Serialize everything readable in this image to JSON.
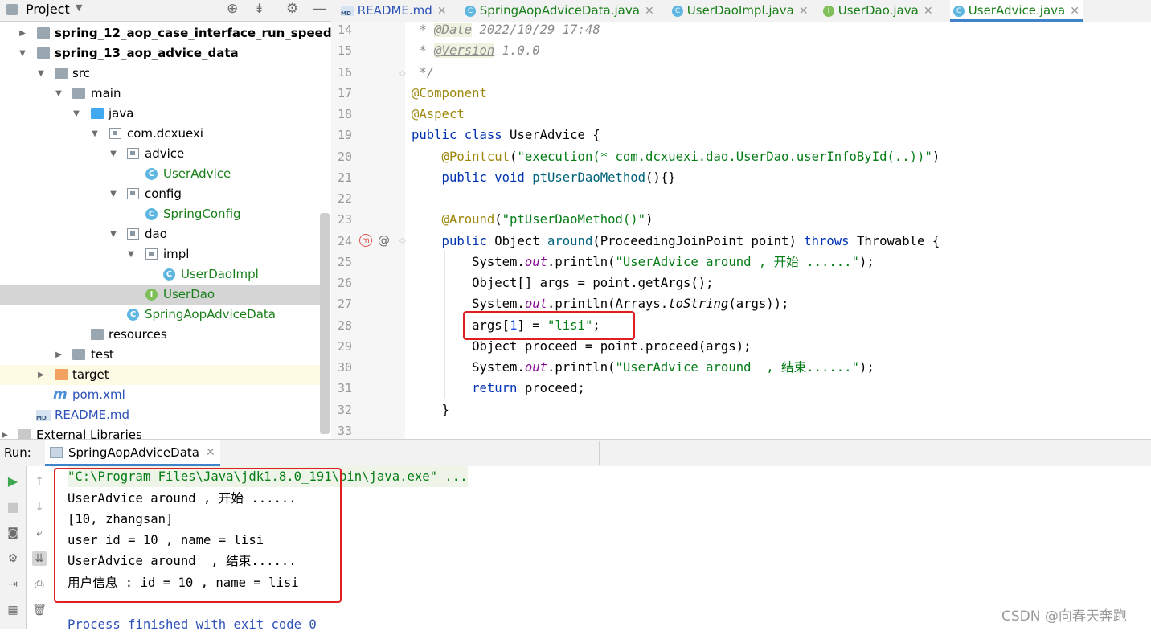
{
  "project_panel": {
    "title": "Project",
    "items": [
      {
        "label": "spring_12_aop_case_interface_run_speed"
      },
      {
        "label": "spring_13_aop_advice_data"
      },
      {
        "label": "src"
      },
      {
        "label": "main"
      },
      {
        "label": "java"
      },
      {
        "label": "com.dcxuexi"
      },
      {
        "label": "advice"
      },
      {
        "label": "UserAdvice"
      },
      {
        "label": "config"
      },
      {
        "label": "SpringConfig"
      },
      {
        "label": "dao"
      },
      {
        "label": "impl"
      },
      {
        "label": "UserDaoImpl"
      },
      {
        "label": "UserDao"
      },
      {
        "label": "SpringAopAdviceData"
      },
      {
        "label": "resources"
      },
      {
        "label": "test"
      },
      {
        "label": "target"
      },
      {
        "label": "pom.xml"
      },
      {
        "label": "README.md"
      },
      {
        "label": "External Libraries"
      }
    ]
  },
  "editor": {
    "tabs": [
      {
        "label": "README.md"
      },
      {
        "label": "SpringAopAdviceData.java"
      },
      {
        "label": "UserDaoImpl.java"
      },
      {
        "label": "UserDao.java"
      },
      {
        "label": "UserAdvice.java"
      }
    ],
    "line_numbers": [
      "14",
      "15",
      "16",
      "17",
      "18",
      "19",
      "20",
      "21",
      "22",
      "23",
      "24",
      "25",
      "26",
      "27",
      "28",
      "29",
      "30",
      "31",
      "32",
      "33"
    ],
    "code": {
      "l14a": " * ",
      "l14b": "@Date",
      "l14c": " 2022/10/29 17:48",
      "l15a": " * ",
      "l15b": "@Version",
      "l15c": " 1.0.0",
      "l16": " */",
      "l17": "@Component",
      "l18": "@Aspect",
      "l19a": "public class",
      "l19b": " UserAdvice {",
      "l20a": "    @Pointcut",
      "l20b": "(",
      "l20c": "\"execution(* com.dcxuexi.dao.UserDao.userInfoById(..))\"",
      "l20d": ")",
      "l21a": "    public void",
      "l21b": " ptUserDaoMethod",
      "l21c": "(){}",
      "l23a": "    @Around",
      "l23b": "(",
      "l23c": "\"ptUserDaoMethod()\"",
      "l23d": ")",
      "l24a": "    public",
      "l24b": " Object ",
      "l24c": "around",
      "l24d": "(ProceedingJoinPoint point) ",
      "l24e": "throws",
      "l24f": " Throwable {",
      "l25a": "        System.",
      "l25b": "out",
      "l25c": ".println(",
      "l25d": "\"UserAdvice around , 开始 ......\"",
      "l25e": ");",
      "l26": "        Object[] args = point.getArgs();",
      "l27a": "        System.",
      "l27b": "out",
      "l27c": ".println(Arrays.",
      "l27d": "toString",
      "l27e": "(args));",
      "l28a": "        args[",
      "l28b": "1",
      "l28c": "] = ",
      "l28d": "\"lisi\"",
      "l28e": ";",
      "l29": "        Object proceed = point.proceed(args);",
      "l30a": "        System.",
      "l30b": "out",
      "l30c": ".println(",
      "l30d": "\"UserAdvice around  , 结束......\"",
      "l30e": ");",
      "l31a": "        return",
      "l31b": " proceed;",
      "l32": "    }"
    }
  },
  "run_panel": {
    "label": "Run:",
    "tab": "SpringAopAdviceData",
    "output": [
      "\"C:\\Program Files\\Java\\jdk1.8.0_191\\bin\\java.exe\" ...",
      "UserAdvice around , 开始 ......",
      "[10, zhangsan]",
      "user id = 10 , name = lisi",
      "UserAdvice around  , 结束......",
      "用户信息 : id = 10 , name = lisi",
      "",
      "Process finished with exit code 0"
    ]
  },
  "watermark": "CSDN @向春天奔跑"
}
